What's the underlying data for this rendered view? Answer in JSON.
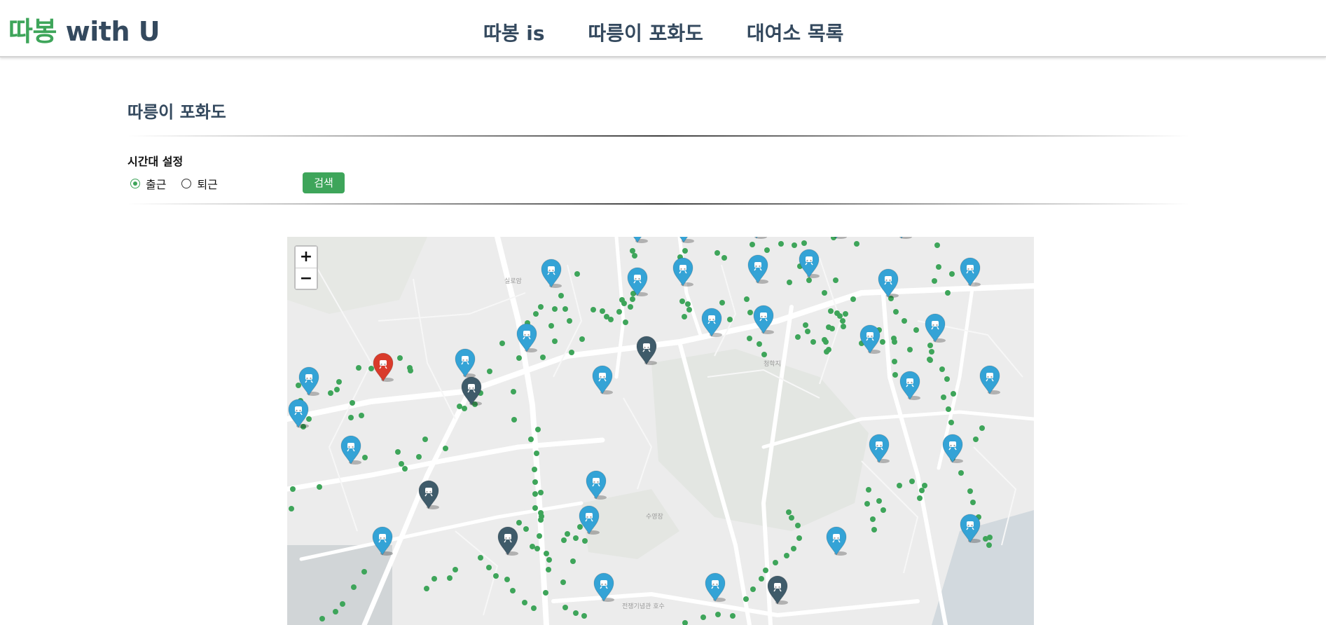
{
  "header": {
    "logo_brand": "따봉",
    "logo_rest": " with U",
    "nav": [
      "따봉 is",
      "따릉이 포화도",
      "대여소 목록"
    ]
  },
  "main": {
    "title": "따릉이 포화도",
    "time_label": "시간대 설정",
    "options": [
      {
        "label": "출근",
        "checked": true
      },
      {
        "label": "퇴근",
        "checked": false
      }
    ],
    "search_label": "검색"
  },
  "map": {
    "zoom_in": "+",
    "zoom_out": "−",
    "place_labels": [
      "실로암",
      "청학지",
      "수영장",
      "전쟁기념관 호수"
    ],
    "marker_colors": {
      "station": "#34a3d6",
      "selected": "#d93b2b",
      "dark": "#3f5b6a",
      "dot": "#3ea55a"
    },
    "legend_note": ""
  }
}
